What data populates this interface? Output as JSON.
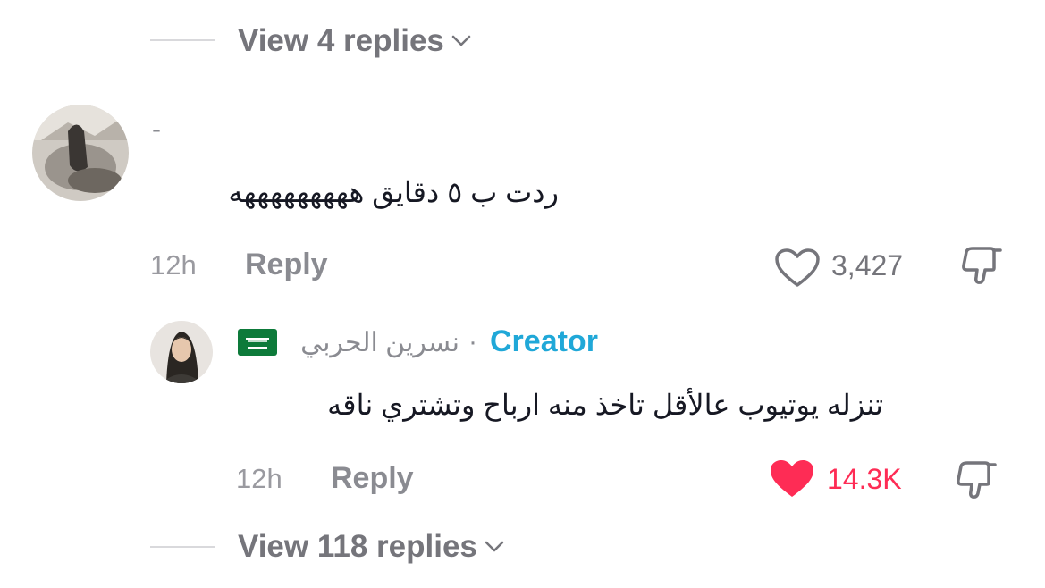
{
  "top_thread": {
    "view_replies_label": "View 4 replies"
  },
  "comment": {
    "username": "-",
    "text": "ردت ب ٥ دقايق هههههههههه",
    "time": "12h",
    "reply_label": "Reply",
    "likes": "3,427",
    "liked": false
  },
  "reply": {
    "username": "نسرين الحربي",
    "flag": "saudi-arabia-flag",
    "separator": "·",
    "badge": "Creator",
    "text": "تنزله يوتيوب عالأقل تاخذ منه ارباح وتشتري ناقه",
    "time": "12h",
    "reply_label": "Reply",
    "likes": "14.3K",
    "liked": true
  },
  "bottom_thread": {
    "view_replies_label": "View 118 replies"
  },
  "colors": {
    "like_red": "#fe2c55",
    "creator_blue": "#20a8d8",
    "muted": "#8a8b91"
  }
}
